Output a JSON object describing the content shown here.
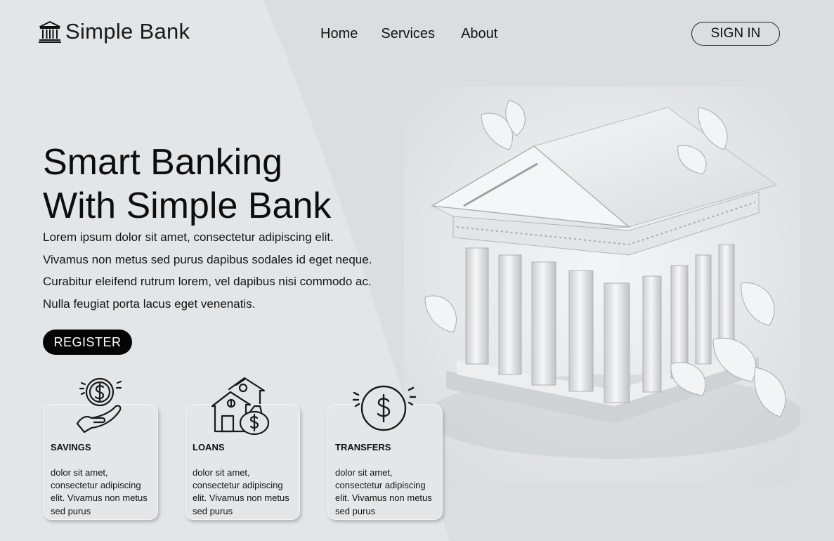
{
  "brand": {
    "name": "Simple Bank",
    "icon": "bank-icon"
  },
  "nav": {
    "items": [
      "Home",
      "Services",
      "About"
    ]
  },
  "header": {
    "signin_label": "SIGN IN"
  },
  "hero": {
    "title_line1": "Smart Banking",
    "title_line2": "With Simple Bank",
    "paragraph_lines": [
      "Lorem ipsum dolor sit amet, consectetur adipiscing elit.",
      "Vivamus non metus sed purus dapibus sodales id eget neque.",
      "Curabitur eleifend rutrum lorem, vel dapibus nisi commodo ac.",
      "Nulla feugiat porta lacus eget venenatis."
    ],
    "register_label": "REGISTER",
    "image": "bank-building-illustration"
  },
  "cards": [
    {
      "title": "SAVINGS",
      "icon": "hand-coin-icon",
      "text": "dolor sit amet, consectetur adipiscing elit. Vivamus non metus sed purus"
    },
    {
      "title": "LOANS",
      "icon": "house-money-bag-icon",
      "text": "dolor sit amet, consectetur adipiscing elit. Vivamus non metus sed purus"
    },
    {
      "title": "TRANSFERS",
      "icon": "dollar-coin-icon",
      "text": "dolor sit amet, consectetur adipiscing elit. Vivamus non metus sed purus"
    }
  ],
  "colors": {
    "background": "#e3e6e8",
    "accent_dark": "#050505",
    "text": "#111111"
  }
}
